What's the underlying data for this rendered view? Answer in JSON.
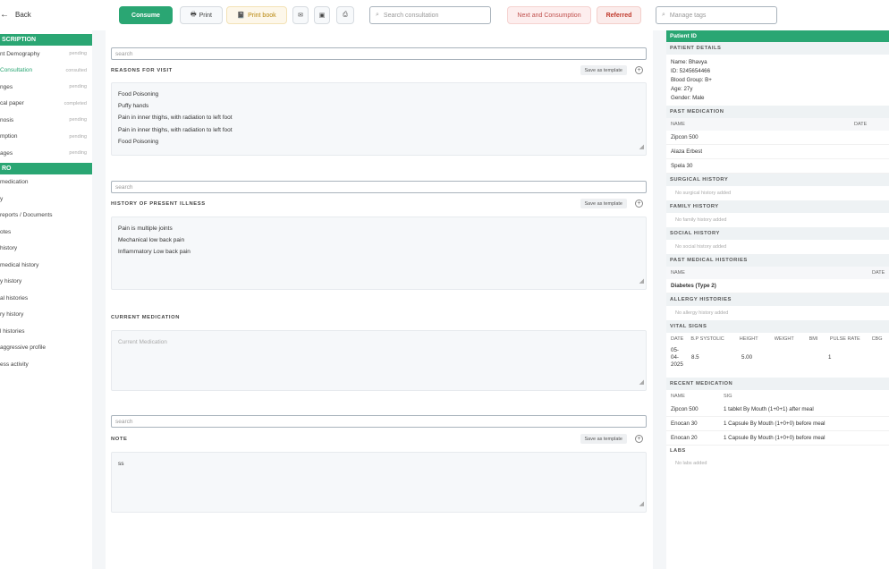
{
  "header": {
    "back_label": "Back",
    "consume_label": "Consume",
    "print_label": "Print",
    "print_book_label": "Print book",
    "search_consultation_placeholder": "Search consultation",
    "next_label": "Next and Consumption",
    "referred_label": "Referred",
    "search_right_placeholder": "Manage tags"
  },
  "sidebar": {
    "section1_title": "SCRIPTION",
    "items1": [
      {
        "label": "nt Demography",
        "status": "pending"
      },
      {
        "label": "Consultation",
        "status": "consulted"
      },
      {
        "label": "nges",
        "status": "pending"
      },
      {
        "label": "cal paper",
        "status": "completed"
      },
      {
        "label": "nosis",
        "status": "pending"
      },
      {
        "label": "mption",
        "status": "pending"
      },
      {
        "label": "ages",
        "status": "pending"
      }
    ],
    "section2_title": "RO",
    "items2": [
      "medication",
      "y",
      "reports / Documents",
      "otes",
      "history",
      "medical history",
      "y history",
      "al histories",
      "ry history",
      "l histories",
      "aggressive profile",
      "ess activity"
    ]
  },
  "form": {
    "reason": {
      "search_placeholder": "search",
      "title": "REASONS FOR VISIT",
      "template_label": "Save as template",
      "lines": [
        "Food Poisoning",
        "Puffy hands",
        "Pain in inner thighs, with radiation to left foot",
        "Pain in inner thighs, with radiation to left foot",
        "Food Poisoning"
      ]
    },
    "illness": {
      "search_placeholder": "search",
      "title": "HISTORY OF PRESENT ILLNESS",
      "template_label": "Save as template",
      "lines": [
        "Pain is multiple joints",
        "Mechanical low back pain",
        "Inflammatory Low back pain"
      ]
    },
    "medication": {
      "title": "CURRENT MEDICATION",
      "placeholder": "Current Medication"
    },
    "note": {
      "search_placeholder": "search",
      "title": "NOTE",
      "template_label": "Save as template",
      "text": "ss"
    }
  },
  "right_panel": {
    "header": "Patient ID",
    "details_title": "PATIENT DETAILS",
    "details": [
      "Name: Bhavya",
      "ID: 5245654466",
      "Blood Group: B+",
      "Age: 27y",
      "Gender: Male"
    ],
    "past_medication_title": "PAST MEDICATION",
    "past_med_cols": [
      "NAME",
      "DATE"
    ],
    "past_meds": [
      "Zipcon 500",
      "Alaza Erbest",
      "Spela 30"
    ],
    "surgical_title": "SURGICAL HISTORY",
    "surgical_empty": "No surgical history added",
    "family_title": "FAMILY HISTORY",
    "family_empty": "No family history added",
    "social_title": "SOCIAL HISTORY",
    "social_empty": "No social history added",
    "past_medical_title": "PAST MEDICAL HISTORIES",
    "past_medical_cols": [
      "NAME",
      "DATE"
    ],
    "past_medical_rows": [
      "Diabetes (Type 2)"
    ],
    "allergy_title": "ALLERGY HISTORIES",
    "allergy_empty": "No allergy history added",
    "vitals_title": "VITAL SIGNS",
    "vitals_cols": [
      "DATE",
      "B.P SYSTOLIC",
      "HEIGHT",
      "WEIGHT",
      "BMI",
      "PULSE RATE",
      "CBG"
    ],
    "vitals_row": {
      "date_l1": "05-",
      "date_l2": "04-",
      "date_l3": "2025",
      "bp": "8.5",
      "height": "5.00",
      "pulse": "1"
    },
    "recent_med_title": "RECENT MEDICATION",
    "recent_med_cols": [
      "NAME",
      "SIG"
    ],
    "recent_meds": [
      {
        "name": "Zipcon 500",
        "sig": "1 tablet By Mouth (1+0+1) after meal"
      },
      {
        "name": "Enocan 30",
        "sig": "1 Capsule By Mouth (1+0+0) before meal"
      },
      {
        "name": "Enocan 20",
        "sig": "1 Capsule By Mouth (1+0+0) before meal"
      }
    ],
    "labs_title": "LABS",
    "labs_empty": "No labs added"
  }
}
